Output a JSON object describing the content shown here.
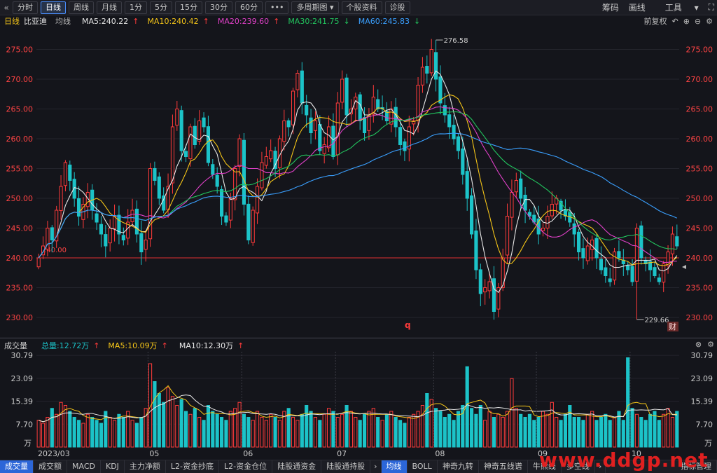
{
  "toolbar": {
    "back_icon": "double-chevron-left-icon",
    "periods": [
      "分时",
      "日线",
      "周线",
      "月线",
      "1分",
      "5分",
      "15分",
      "30分",
      "60分"
    ],
    "active_period": "日线",
    "more_label": "•••",
    "multi_period_label": "多周期图",
    "stock_info_label": "个股资料",
    "diagnosis_label": "诊股",
    "right": [
      "筹码",
      "画线",
      "工具"
    ],
    "right_icons": [
      "dropdown-icon",
      "expand-icon",
      "close-icon"
    ]
  },
  "legend": {
    "period": "日线",
    "stock": "比亚迪",
    "ma_label": "均线",
    "items": [
      {
        "text": "MA5:240.22",
        "arrow": "↑",
        "color": "#e8e8e8",
        "arrow_color": "#ff3b3b"
      },
      {
        "text": "MA10:240.42",
        "arrow": "↑",
        "color": "#f5c518",
        "arrow_color": "#ff3b3b"
      },
      {
        "text": "MA20:239.60",
        "arrow": "↑",
        "color": "#e040c8",
        "arrow_color": "#ff3b3b"
      },
      {
        "text": "MA30:241.75",
        "arrow": "↓",
        "color": "#22c55e",
        "arrow_color": "#22c55e"
      },
      {
        "text": "MA60:245.83",
        "arrow": "↓",
        "color": "#3aa0ff",
        "arrow_color": "#22c55e"
      }
    ],
    "right_label": "前复权",
    "right_icons": [
      "undo-icon",
      "zoom-in-icon",
      "zoom-out-icon",
      "settings-icon"
    ]
  },
  "volume_header": {
    "title": "成交量",
    "total": "总量:12.72万",
    "ma5": "MA5:10.09万",
    "ma10": "MA10:12.30万",
    "total_arrow": "↑",
    "ma5_arrow": "↑",
    "ma10_arrow": "↑"
  },
  "bottom_tabs": [
    "成交量",
    "成交额",
    "MACD",
    "KDJ",
    "主力净额",
    "L2-资金抄底",
    "L2-资金仓位",
    "陆股通资金",
    "陆股通持股",
    "›",
    "均线",
    "BOLL",
    "神奇九转",
    "神奇五线谱",
    "牛熊线",
    "多空线",
    "›",
    "指标管理"
  ],
  "active_bottom_tabs": [
    "成交量",
    "均线"
  ],
  "watermark": "www.ddgp.net",
  "chart_data": [
    {
      "type": "candlestick",
      "title": "比亚迪 日线",
      "yticks": [
        230.0,
        235.0,
        240.0,
        245.0,
        250.0,
        255.0,
        260.0,
        265.0,
        270.0,
        275.0
      ],
      "ylim": [
        228,
        278
      ],
      "x_month_labels": [
        {
          "label": "2023/03",
          "index": 0
        },
        {
          "label": "05",
          "index": 25
        },
        {
          "label": "06",
          "index": 46
        },
        {
          "label": "07",
          "index": 67
        },
        {
          "label": "08",
          "index": 89
        },
        {
          "label": "09",
          "index": 112
        },
        {
          "label": "10",
          "index": 133
        }
      ],
      "reference_line": {
        "value": 240.0,
        "label": "240.00"
      },
      "annotations": [
        {
          "label": "276.58",
          "value": 276.58,
          "index": 89
        },
        {
          "label": "229.66",
          "value": 229.66,
          "index": 134
        }
      ],
      "markers": {
        "q_label": "q",
        "cai_label": "财"
      },
      "closes": [
        240,
        242,
        245,
        243,
        248,
        252,
        256,
        253,
        250,
        247,
        249,
        251,
        248,
        246,
        244,
        242,
        245,
        247,
        244,
        243,
        246,
        248,
        244,
        241,
        243,
        255,
        253,
        250,
        248,
        252,
        262,
        265,
        258,
        257,
        262,
        259,
        263,
        262,
        256,
        254,
        252,
        247,
        246,
        250,
        255,
        260,
        249,
        243,
        248,
        252,
        256,
        257,
        258,
        255,
        260,
        263,
        262,
        268,
        271,
        266,
        264,
        261,
        263,
        258,
        259,
        262,
        257,
        266,
        270,
        264,
        265,
        267,
        263,
        261,
        264,
        267,
        265,
        265,
        263,
        265,
        262,
        259,
        258,
        262,
        263,
        269,
        272,
        271,
        275,
        270,
        266,
        264,
        262,
        260,
        258,
        254,
        250,
        244,
        238,
        234,
        235,
        236,
        231,
        235,
        240,
        247,
        251,
        253,
        250,
        248,
        247,
        246,
        244,
        245,
        247,
        249,
        250,
        248,
        247,
        246,
        244,
        241,
        240,
        242,
        243,
        240,
        238,
        237,
        236,
        241,
        240,
        239,
        238,
        236,
        245,
        240,
        239,
        238,
        237,
        236,
        239,
        241,
        244,
        242
      ],
      "ma5_last": 240.22,
      "ma10_last": 240.42,
      "ma20_last": 239.6,
      "ma30_last": 241.75,
      "ma60_last": 245.83
    },
    {
      "type": "bar",
      "title": "成交量",
      "unit": "万",
      "yticks": [
        7.7,
        15.39,
        23.09,
        30.79
      ],
      "ylim": [
        0,
        32
      ],
      "volumes": [
        9,
        8,
        10,
        13,
        11,
        15,
        14,
        12,
        10,
        9,
        8,
        11,
        10,
        9,
        8,
        12,
        10,
        9,
        11,
        10,
        12,
        9,
        8,
        10,
        13,
        28,
        22,
        18,
        15,
        20,
        17,
        14,
        16,
        12,
        11,
        13,
        10,
        9,
        14,
        12,
        11,
        10,
        9,
        12,
        13,
        15,
        11,
        10,
        9,
        12,
        10,
        9,
        11,
        10,
        9,
        12,
        13,
        10,
        9,
        11,
        14,
        12,
        10,
        9,
        11,
        13,
        12,
        10,
        11,
        14,
        12,
        10,
        9,
        11,
        12,
        13,
        10,
        9,
        11,
        12,
        10,
        9,
        8,
        10,
        11,
        12,
        14,
        18,
        16,
        13,
        12,
        10,
        11,
        9,
        12,
        14,
        27,
        13,
        11,
        14,
        9,
        12,
        10,
        11,
        10,
        12,
        23,
        13,
        11,
        10,
        11,
        9,
        10,
        12,
        11,
        15,
        10,
        9,
        11,
        14,
        10,
        10,
        9,
        11,
        12,
        9,
        10,
        11,
        9,
        10,
        12,
        9,
        30,
        13,
        11,
        10,
        9,
        11,
        12,
        9,
        11,
        13,
        10,
        12
      ],
      "ma5_last": 10.09,
      "ma10_last": 12.3
    }
  ],
  "colors": {
    "up": "#ff3b3b",
    "down": "#1cc3c8",
    "ma5": "#e8e8e8",
    "ma10": "#f5c518",
    "ma20": "#e040c8",
    "ma30": "#22c55e",
    "ma60": "#3aa0ff",
    "axis_text": "#ff4444",
    "grid": "#24252d"
  }
}
